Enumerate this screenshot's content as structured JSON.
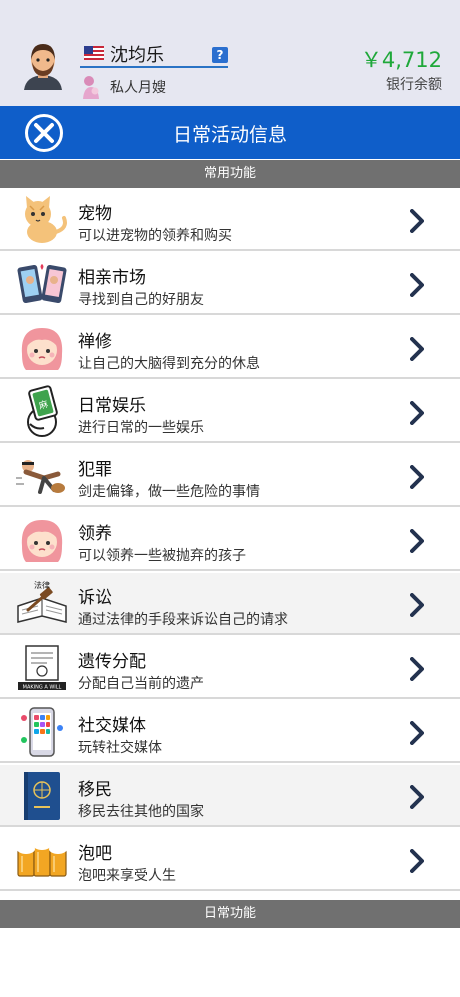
{
  "profile": {
    "username": "沈均乐",
    "help_label": "?",
    "occupation": "私人月嫂",
    "money": "￥4,712",
    "money_label": "银行余额",
    "flag_icon": "us-flag-icon"
  },
  "header": {
    "title": "日常活动信息",
    "close_icon": "close-icon"
  },
  "sections": [
    {
      "label": "常用功能"
    },
    {
      "label": "日常功能"
    }
  ],
  "activities": [
    {
      "title": "宠物",
      "desc": "可以进宠物的领养和购买",
      "icon": "cat-icon"
    },
    {
      "title": "相亲市场",
      "desc": "寻找到自己的好朋友",
      "icon": "dating-phones-icon"
    },
    {
      "title": "禅修",
      "desc": "让自己的大脑得到充分的休息",
      "icon": "girl-face-icon"
    },
    {
      "title": "日常娱乐",
      "desc": "进行日常的一些娱乐",
      "icon": "mahjong-icon"
    },
    {
      "title": "犯罪",
      "desc": "剑走偏锋，做一些危险的事情",
      "icon": "thief-icon"
    },
    {
      "title": "领养",
      "desc": "可以领养一些被抛弃的孩子",
      "icon": "girl-face-icon"
    },
    {
      "title": "诉讼",
      "desc": "通过法律的手段来诉讼自己的请求",
      "icon": "law-book-icon",
      "icon_text": "法律"
    },
    {
      "title": "遗传分配",
      "desc": "分配自己当前的遗产",
      "icon": "will-document-icon",
      "icon_text": "MAKING A WILL"
    },
    {
      "title": "社交媒体",
      "desc": "玩转社交媒体",
      "icon": "smartphone-apps-icon"
    },
    {
      "title": "移民",
      "desc": "移民去往其他的国家",
      "icon": "passport-icon"
    },
    {
      "title": "泡吧",
      "desc": "泡吧来享受人生",
      "icon": "beer-mugs-icon"
    }
  ],
  "colors": {
    "header_blue": "#0f5ec9",
    "money_green": "#1fa83a",
    "section_gray": "#707070",
    "chevron_navy": "#23324f"
  }
}
